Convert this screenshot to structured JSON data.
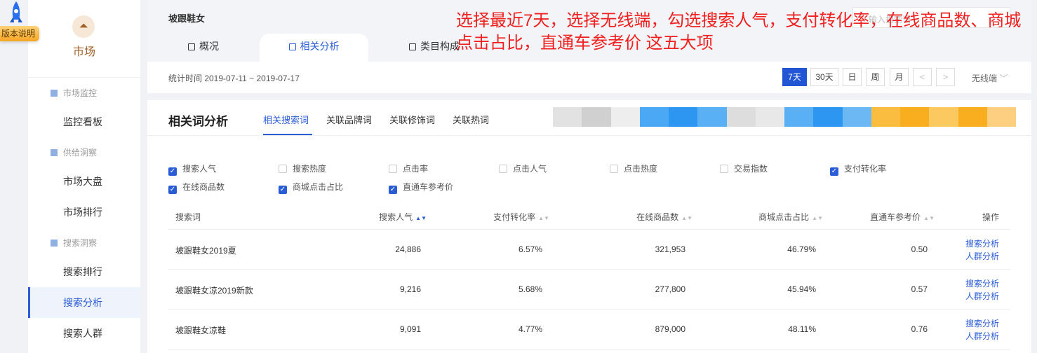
{
  "version_badge": "版本说明",
  "sidebar": {
    "market": "市场",
    "groups": [
      {
        "label": "市场监控",
        "items": [
          "监控看板"
        ]
      },
      {
        "label": "供给洞察",
        "items": [
          "市场大盘",
          "市场排行"
        ]
      },
      {
        "label": "搜索洞察",
        "items": [
          "搜索排行",
          "搜索分析",
          "搜索人群"
        ]
      }
    ],
    "active": "搜索分析"
  },
  "header": {
    "title": "坡跟鞋女",
    "tabs": [
      "概况",
      "相关分析",
      "类目构成"
    ],
    "active_tab": "相关分析",
    "search_placeholder": "输入搜索词",
    "stat_time": "统计时间 2019-07-11 ~ 2019-07-17",
    "periods": [
      "7天",
      "30天",
      "日",
      "周",
      "月"
    ],
    "active_period": "7天",
    "prev": "<",
    "next": ">",
    "device": "无线端"
  },
  "annotation": "选择最近7天，选择无线端，勾选搜索人气，支付转化率，在线商品数、商城点击占比，直通车参考价 这五大项",
  "panel": {
    "title": "相关词分析",
    "subtabs": [
      "相关搜索词",
      "关联品牌词",
      "关联修饰词",
      "关联热词"
    ],
    "active_subtab": "相关搜索词",
    "metrics": [
      {
        "label": "搜索人气",
        "checked": true
      },
      {
        "label": "搜索热度",
        "checked": false
      },
      {
        "label": "点击率",
        "checked": false
      },
      {
        "label": "点击人气",
        "checked": false
      },
      {
        "label": "点击热度",
        "checked": false
      },
      {
        "label": "交易指数",
        "checked": false
      },
      {
        "label": "支付转化率",
        "checked": true
      },
      {
        "label": "在线商品数",
        "checked": true
      },
      {
        "label": "商城点击占比",
        "checked": true
      },
      {
        "label": "直通车参考价",
        "checked": true
      }
    ],
    "columns": [
      "搜索词",
      "搜索人气",
      "支付转化率",
      "在线商品数",
      "商城点击占比",
      "直通车参考价",
      "操作"
    ],
    "rows": [
      {
        "word": "坡跟鞋女2019夏",
        "pop": "24,886",
        "conv": "6.57%",
        "goods": "321,953",
        "mall": "46.79%",
        "ztc": "0.50"
      },
      {
        "word": "坡跟鞋女凉2019新款",
        "pop": "9,216",
        "conv": "5.68%",
        "goods": "277,800",
        "mall": "45.94%",
        "ztc": "0.57"
      },
      {
        "word": "坡跟鞋女凉鞋",
        "pop": "9,091",
        "conv": "4.77%",
        "goods": "879,000",
        "mall": "48.11%",
        "ztc": "0.76"
      }
    ],
    "actions": [
      "搜索分析",
      "人群分析"
    ]
  }
}
